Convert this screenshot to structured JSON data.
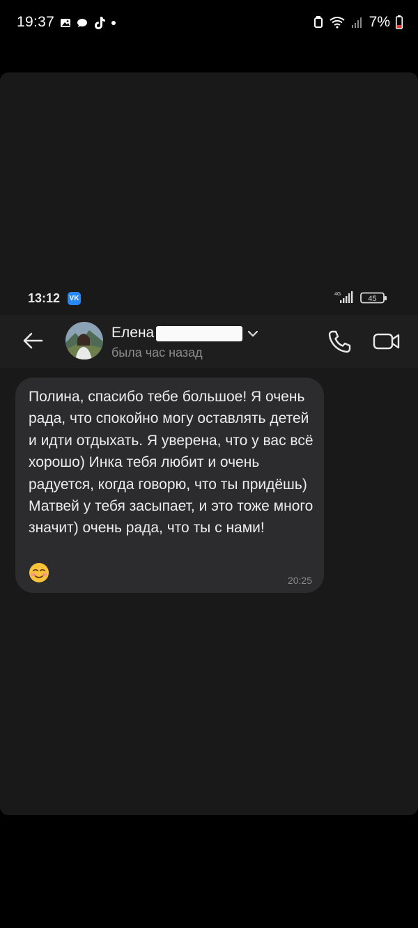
{
  "phone_status": {
    "time": "19:37",
    "battery": "7%"
  },
  "inner_status": {
    "time": "13:12",
    "app_badge": "VK",
    "network": "4G",
    "battery": "45"
  },
  "chat_header": {
    "name": "Елена",
    "status": "была час назад"
  },
  "message": {
    "text": "Полина, спасибо тебе большое! Я очень рада, что спокойно могу оставлять детей и идти отдыхать. Я уверена, что у вас всё хорошо) Инка тебя любит и очень радуется, когда говорю, что ты придёшь) Матвей у тебя засыпает, и это тоже много значит) очень рада, что ты с нами!",
    "emoji": "☺️",
    "time": "20:25"
  },
  "colors": {
    "bubble": "#2c2c2e",
    "background": "#191919",
    "vk_badge": "#2787f5"
  },
  "icons": [
    "image-icon",
    "chat-icon",
    "tiktok-icon",
    "alarm-icon",
    "wifi-icon",
    "signal-icon",
    "battery-icon",
    "vk-icon",
    "back-arrow-icon",
    "chevron-down-icon",
    "phone-icon",
    "video-camera-icon"
  ]
}
